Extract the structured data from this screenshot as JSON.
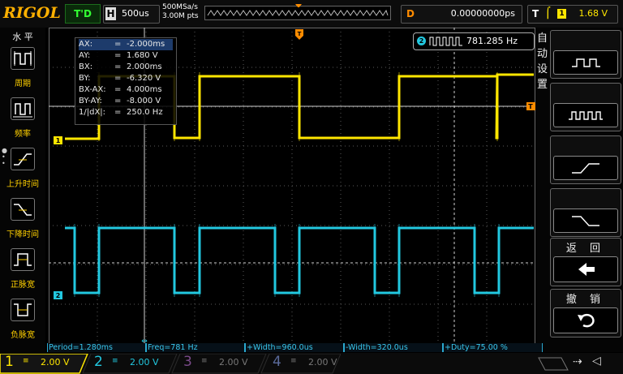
{
  "topbar": {
    "logo": "RIGOL",
    "run_status": "T'D",
    "horizontal_label": "H",
    "timebase": "500us",
    "sample_rate": "500MSa/s",
    "mem_depth": "3.00M pts",
    "delay_label": "D",
    "delay_value": "0.00000000ps",
    "trigger_label": "T",
    "trigger_edge_icon": "rising-edge-icon",
    "trigger_source": "1",
    "trigger_level": "1.68 V"
  },
  "left_menu": {
    "title": "水 平",
    "items": [
      {
        "label": "周期",
        "icon": "period-icon"
      },
      {
        "label": "频率",
        "icon": "frequency-icon"
      },
      {
        "label": "上升时间",
        "icon": "rise-time-icon"
      },
      {
        "label": "下降时间",
        "icon": "fall-time-icon"
      },
      {
        "label": "正脉宽",
        "icon": "positive-width-icon"
      },
      {
        "label": "负脉宽",
        "icon": "negative-width-icon"
      }
    ]
  },
  "right_menu": {
    "title": "自动设置",
    "buttons": [
      {
        "icon": "multi-period-icon"
      },
      {
        "icon": "single-period-icon"
      },
      {
        "icon": "rise-edge-icon"
      },
      {
        "icon": "fall-edge-icon"
      }
    ],
    "back_label": "返 回",
    "back_icon": "arrow-left-icon",
    "undo_label": "撤 销",
    "undo_icon": "undo-icon"
  },
  "cursor_readout": [
    {
      "key": "AX:",
      "value": "-2.000ms"
    },
    {
      "key": "AY:",
      "value": "1.680 V"
    },
    {
      "key": "BX:",
      "value": "2.000ms"
    },
    {
      "key": "BY:",
      "value": "-6.320 V"
    },
    {
      "key": "BX-AX:",
      "value": "4.000ms"
    },
    {
      "key": "BY-AY:",
      "value": "-8.000 V"
    },
    {
      "key": "1/|dX|:",
      "value": "250.0 Hz"
    }
  ],
  "cursor_eq": "=",
  "freq_counter": {
    "channel": "2",
    "value": "781.285 Hz"
  },
  "markers": {
    "ch1": "1",
    "ch2": "2",
    "trigger": "T"
  },
  "measurements": [
    "Period=1.280ms",
    "Freq=781 Hz",
    "+Width=960.0us",
    "-Width=320.0us",
    "+Duty=75.00 %"
  ],
  "channels": [
    {
      "num": "1",
      "scale": "2.00 V",
      "color": "#ffe600"
    },
    {
      "num": "2",
      "scale": "2.00 V",
      "color": "#22c8e0"
    },
    {
      "num": "3",
      "scale": "2.00 V",
      "color": "#b04ad0"
    },
    {
      "num": "4",
      "scale": "2.00 V",
      "color": "#3a6ad0"
    }
  ],
  "colors": {
    "ch1": "#ffe600",
    "ch2": "#22c8e0",
    "accent": "#ff8c00"
  }
}
